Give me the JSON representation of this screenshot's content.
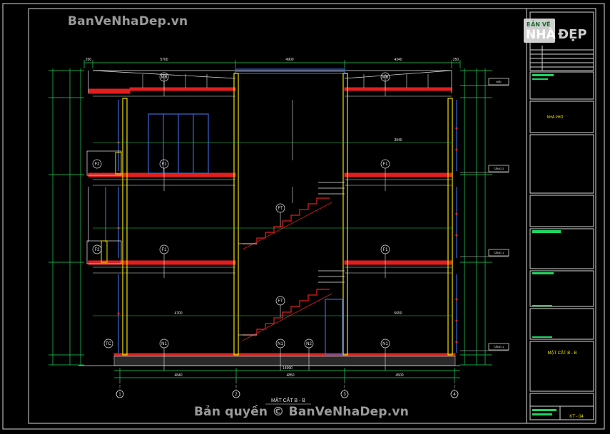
{
  "watermark": {
    "top": "BanVeNhaDep.vn",
    "bottom": "Bản quyền © BanVeNhaDep.vn",
    "logo_line1": "BẢN VẼ",
    "logo_line2": "NHÀ",
    "logo_line3": "ĐẸP"
  },
  "drawing": {
    "section_title": "MẶT CẮT B - B",
    "sheet_title": "MẶT CẮT B - B",
    "sheet_code": "KT - 04",
    "title_block_name": "NHÀ PHỐ"
  },
  "grid_axes": [
    "1",
    "2",
    "3",
    "4"
  ],
  "labels": {
    "mb": "MB",
    "f1": "F1",
    "f2": "F2",
    "ft": "FT",
    "n1": "N1",
    "n2": "N2",
    "tc": "TC"
  },
  "bottom_dims": {
    "overall": "14090",
    "span_a": "4840",
    "span_b": "4850",
    "span_c": "4500"
  },
  "top_dims": [
    "250",
    "5700",
    "4900",
    "4340",
    "250"
  ],
  "mid_dims": [
    "4700",
    "5650",
    "3940"
  ],
  "level_tags": [
    "MÁI",
    "TẦNG 2",
    "TẦNG 1",
    "TẦNG 1"
  ],
  "colors": {
    "frame": "#d8d8d8",
    "slab": "#e41e1e",
    "column": "#f0e000",
    "stair": "#e41e1e",
    "line": "#e8e8e8",
    "green": "#1ed760",
    "cyan": "#17c7e0",
    "blue": "#3a66d6",
    "magenta": "#e01ec0"
  }
}
